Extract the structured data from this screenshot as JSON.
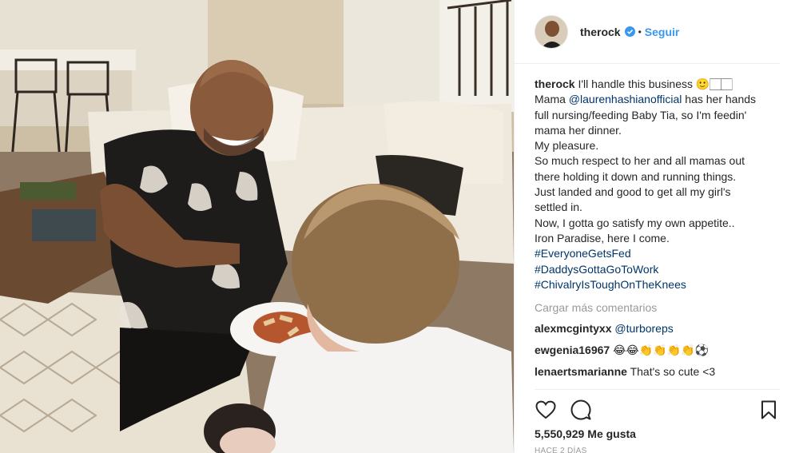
{
  "post": {
    "username": "therock",
    "verified": true,
    "separator": "•",
    "follow_label": "Seguir"
  },
  "caption": {
    "username": "therock",
    "lines": [
      {
        "text": "I'll handle this business 🙂🏻🏻"
      },
      {
        "prefix": "Mama ",
        "mention": "@laurenhashianofficial",
        "suffix": " has her hands"
      },
      {
        "text": "full nursing/feeding Baby Tia, so I'm feedin'"
      },
      {
        "text": "mama her dinner."
      },
      {
        "text": "My pleasure."
      },
      {
        "text": "So much respect to her and all mamas out"
      },
      {
        "text": "there holding it down and running things."
      },
      {
        "text": "Just landed and good to get all my girl's"
      },
      {
        "text": "settled in."
      },
      {
        "text": "Now, I gotta go satisfy my own appetite.."
      },
      {
        "text": "Iron Paradise, here I come."
      }
    ],
    "hashtags": [
      "#EveryoneGetsFed",
      "#DaddysGottaGoToWork",
      "#ChivalryIsToughOnTheKnees"
    ]
  },
  "load_more_label": "Cargar más comentarios",
  "comments": [
    {
      "user": "alexmcgintyxx",
      "mention": "@turboreps",
      "text": ""
    },
    {
      "user": "ewgenia16967",
      "mention": "",
      "text": "😂😂👏👏👏👏⚽"
    },
    {
      "user": "lenaertsmarianne",
      "mention": "",
      "text": "That's so cute <3"
    }
  ],
  "likes": {
    "count": "5,550,929",
    "label": "Me gusta"
  },
  "timestamp": "HACE 2 DÍAS",
  "icons": {
    "like": "heart-icon",
    "comment": "comment-icon",
    "save": "bookmark-icon",
    "verified": "verified-badge-icon"
  },
  "colors": {
    "link": "#003569",
    "follow": "#3897f0",
    "muted": "#999999",
    "verified": "#3897f0"
  }
}
